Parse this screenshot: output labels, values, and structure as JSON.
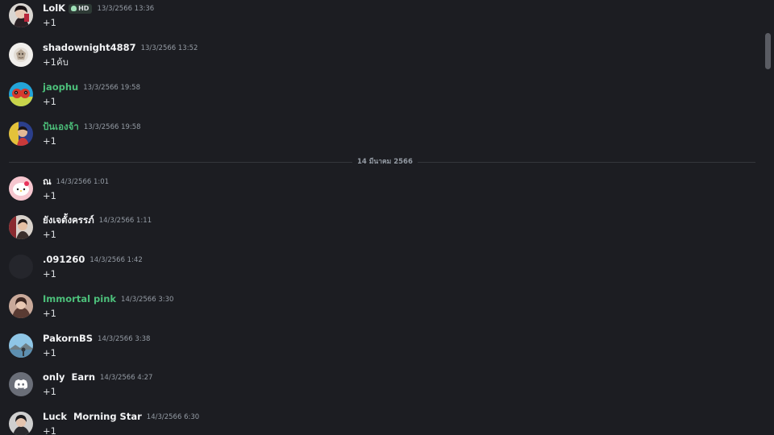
{
  "messages": [
    {
      "username": "LolK",
      "badge": "HD",
      "timestamp": "13/3/2566 13:36",
      "content": "+1"
    },
    {
      "username": "shadownight4887",
      "timestamp": "13/3/2566 13:52",
      "content": "+1ค้บ"
    },
    {
      "username": "jaophu",
      "timestamp": "13/3/2566 19:58",
      "content": "+1",
      "name_color": "#4cbf7a"
    },
    {
      "username": "ป้นเองจ้า",
      "timestamp": "13/3/2566 19:58",
      "content": "+1",
      "name_color": "#4cbf7a"
    },
    {
      "username": "ณ",
      "timestamp": "14/3/2566 1:01",
      "content": "+1"
    },
    {
      "username": "ยังเจตั้งครรภ์",
      "timestamp": "14/3/2566 1:11",
      "content": "+1"
    },
    {
      "username": ".091260",
      "timestamp": "14/3/2566 1:42",
      "content": "+1"
    },
    {
      "username": "Immortal pink",
      "timestamp": "14/3/2566 3:30",
      "content": "+1",
      "name_color": "#4cbf7a"
    },
    {
      "username": "PakornBS",
      "timestamp": "14/3/2566 3:38",
      "content": "+1"
    },
    {
      "username": "only  Earn",
      "timestamp": "14/3/2566 4:27",
      "content": "+1"
    },
    {
      "username": "Luck  Morning Star",
      "timestamp": "14/3/2566 6:30",
      "content": "+1"
    }
  ],
  "date_divider": "14 มีนาคม 2566",
  "icons": {
    "badge_icon": "skull-icon",
    "default_avatar_icon": "discord-logo-icon"
  },
  "colors": {
    "background": "#1c1d22",
    "username": "#f2f3f5",
    "username_role_green": "#4cbf7a",
    "timestamp": "#949ba4",
    "default_avatar": "#5865f2"
  }
}
